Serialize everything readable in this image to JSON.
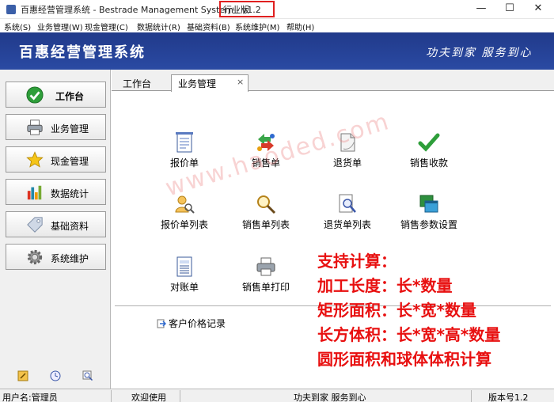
{
  "window": {
    "title": "百惠经营管理系统 - Bestrade Management System - v1.2",
    "edition": "行业版"
  },
  "menu": [
    "系统(S)",
    "业务管理(W)",
    "现金管理(C)",
    "数据统计(R)",
    "基础资料(B)",
    "系统维护(M)",
    "帮助(H)"
  ],
  "banner": {
    "title": "百惠经营管理系统",
    "slogan": "功夫到家 服务到心"
  },
  "sidebar": {
    "items": [
      {
        "label": "工作台",
        "icon": "check-circle-icon",
        "active": true
      },
      {
        "label": "业务管理",
        "icon": "printer-icon"
      },
      {
        "label": "现金管理",
        "icon": "star-icon"
      },
      {
        "label": "数据统计",
        "icon": "bar-chart-icon"
      },
      {
        "label": "基础资料",
        "icon": "tag-icon"
      },
      {
        "label": "系统维护",
        "icon": "gear-icon"
      }
    ]
  },
  "tabs": {
    "home": "工作台",
    "active": "业务管理",
    "close_glyph": "×"
  },
  "functions": [
    {
      "label": "报价单",
      "icon": "document-icon"
    },
    {
      "label": "销售单",
      "icon": "cycle-arrows-icon"
    },
    {
      "label": "退货单",
      "icon": "return-document-icon"
    },
    {
      "label": "销售收款",
      "icon": "checkmark-icon"
    },
    {
      "label": "报价单列表",
      "icon": "user-search-icon"
    },
    {
      "label": "销售单列表",
      "icon": "magnifier-icon"
    },
    {
      "label": "退货单列表",
      "icon": "search-document-icon"
    },
    {
      "label": "销售参数设置",
      "icon": "windows-icon"
    },
    {
      "label": "对账单",
      "icon": "statement-icon"
    },
    {
      "label": "销售单打印",
      "icon": "print-icon"
    }
  ],
  "record_link": "客户价格记录",
  "watermark": "www.haoded.com",
  "annotations": [
    "支持计算：",
    "加工长度：长*数量",
    "矩形面积：长*宽*数量",
    "长方体积：长*宽*高*数量",
    "圆形面积和球体体积计算"
  ],
  "status": {
    "user": "用户名:管理员",
    "welcome": "欢迎使用",
    "slogan": "功夫到家 服务到心",
    "version": "版本号1.2"
  },
  "colors": {
    "banner": "#213a8a",
    "annotation": "#e81010",
    "edition_box": "#e02020"
  }
}
